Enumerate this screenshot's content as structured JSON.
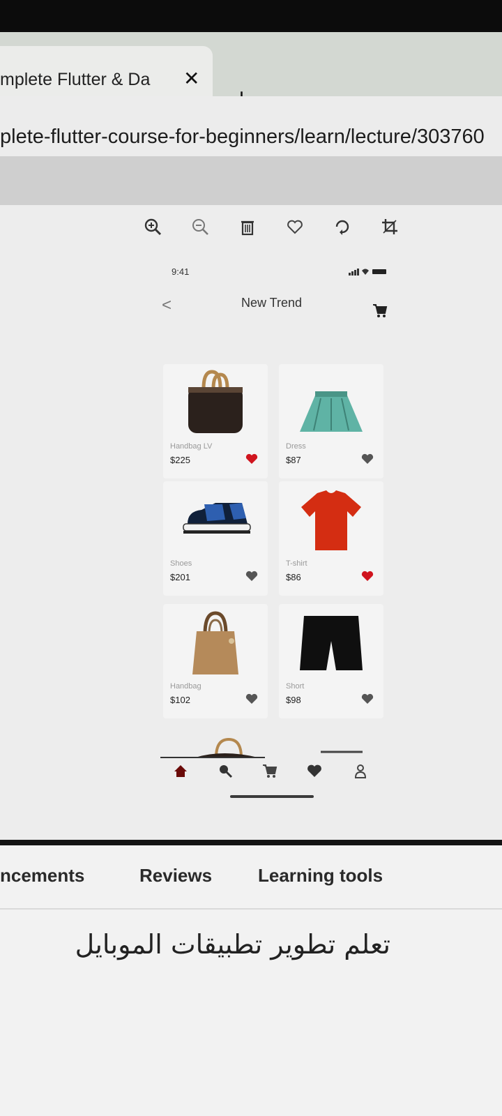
{
  "browser": {
    "tab_title": "mplete Flutter & Da",
    "tab_close": "✕",
    "new_tab": "+",
    "url": "plete-flutter-course-for-beginners/learn/lecture/303760"
  },
  "viewer_toolbar": {
    "icons": [
      "zoom-in-icon",
      "zoom-out-icon",
      "trash-icon",
      "heart-icon",
      "rotate-icon",
      "crop-icon"
    ]
  },
  "phone": {
    "time": "9:41",
    "back": "<",
    "title": "New Trend",
    "products": [
      {
        "name": "Handbag LV",
        "price": "$225",
        "favorite": true
      },
      {
        "name": "Dress",
        "price": "$87",
        "favorite": false
      },
      {
        "name": "Shoes",
        "price": "$201",
        "favorite": false
      },
      {
        "name": "T-shirt",
        "price": "$86",
        "favorite": true
      },
      {
        "name": "Handbag",
        "price": "$102",
        "favorite": false
      },
      {
        "name": "Short",
        "price": "$98",
        "favorite": false
      }
    ],
    "nav": [
      "home-icon",
      "search-icon",
      "cart-icon",
      "heart-icon",
      "profile-icon"
    ]
  },
  "course_tabs": {
    "announcements": "ncements",
    "reviews": "Reviews",
    "learning_tools": "Learning tools"
  },
  "course_title": "تعلم تطوير تطبيقات الموبايل",
  "colors": {
    "favorite": "#d0141e",
    "inactive_heart": "#555555",
    "accent_dark": "#141414"
  }
}
